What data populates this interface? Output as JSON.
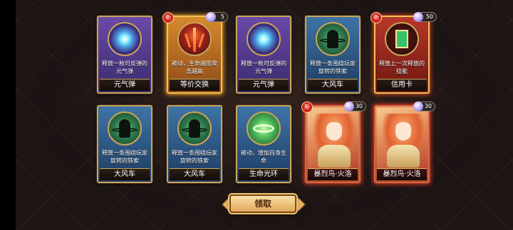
{
  "new_badge": "新",
  "claim_button": "领取",
  "colors": {
    "accent_gold": "#c8a55a",
    "new_badge_red": "#d0221a"
  },
  "row1": [
    {
      "name": "元气弹",
      "desc": "释放一枚可反弹的元气弹",
      "rarity": "purple",
      "icon": "energy-orb-icon",
      "is_new": false
    },
    {
      "name": "等价交换",
      "desc": "被动，生命越低攻击越高",
      "rarity": "orange",
      "icon": "flame-sword-icon",
      "is_new": true,
      "cost": "5"
    },
    {
      "name": "元气弹",
      "desc": "释放一枚可反弹的元气弹",
      "rarity": "purple",
      "icon": "energy-orb-icon",
      "is_new": false
    },
    {
      "name": "大风车",
      "desc": "释放一条围绕玩家旋转的铁索",
      "rarity": "blue",
      "icon": "spinning-chain-icon",
      "is_new": false
    },
    {
      "name": "信用卡",
      "desc": "释放上一次释放的技能",
      "rarity": "red",
      "icon": "card-icon",
      "is_new": true,
      "cost": "50"
    }
  ],
  "row2": [
    {
      "name": "大风车",
      "desc": "释放一条围绕玩家旋转的铁索",
      "rarity": "blue",
      "icon": "spinning-chain-icon"
    },
    {
      "name": "大风车",
      "desc": "释放一条围绕玩家旋转的铁索",
      "rarity": "blue",
      "icon": "spinning-chain-icon"
    },
    {
      "name": "生命光环",
      "desc": "被动，增加自身生命",
      "rarity": "blue",
      "icon": "life-halo-icon"
    },
    {
      "name": "暴烈鸟·火洛",
      "rarity": "hero",
      "is_new": true,
      "cost": "30"
    },
    {
      "name": "暴烈鸟·火洛",
      "rarity": "hero",
      "is_new": false,
      "cost": "30"
    }
  ]
}
